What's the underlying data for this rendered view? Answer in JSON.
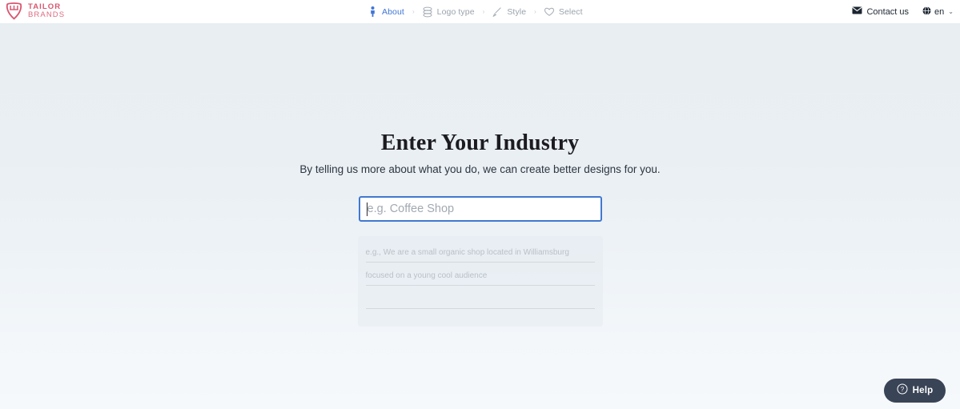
{
  "brand": {
    "line1": "TAILOR",
    "line2": "BRANDS",
    "mark_icon": "tailor-brands-shield-icon",
    "color": "#d9566f"
  },
  "header": {
    "steps": [
      {
        "label": "About",
        "icon": "person-icon",
        "active": true,
        "separator": "›"
      },
      {
        "label": "Logo type",
        "icon": "layers-icon",
        "active": false,
        "separator": "›"
      },
      {
        "label": "Style",
        "icon": "brush-icon",
        "active": false,
        "separator": "›"
      },
      {
        "label": "Select",
        "icon": "heart-icon",
        "active": false,
        "separator": ""
      }
    ],
    "active_color": "#4176d6",
    "inactive_color": "#9aa3ad",
    "contact": {
      "label": "Contact us",
      "icon": "envelope-icon"
    },
    "language": {
      "label": "en",
      "icon": "globe-icon",
      "chevron": "⌄"
    }
  },
  "main": {
    "title": "Enter Your Industry",
    "subtitle": "By telling us more about what you do, we can create better designs for you.",
    "industry_input": {
      "value": "",
      "placeholder": "e.g. Coffee Shop",
      "focused": true,
      "border_color": "#4178cf"
    },
    "description_lines": [
      "e.g., We are a small organic shop located in Williamsburg",
      "focused on a young cool audience",
      ""
    ]
  },
  "help": {
    "label": "Help",
    "icon": "question-circle-icon",
    "background": "#394456"
  }
}
